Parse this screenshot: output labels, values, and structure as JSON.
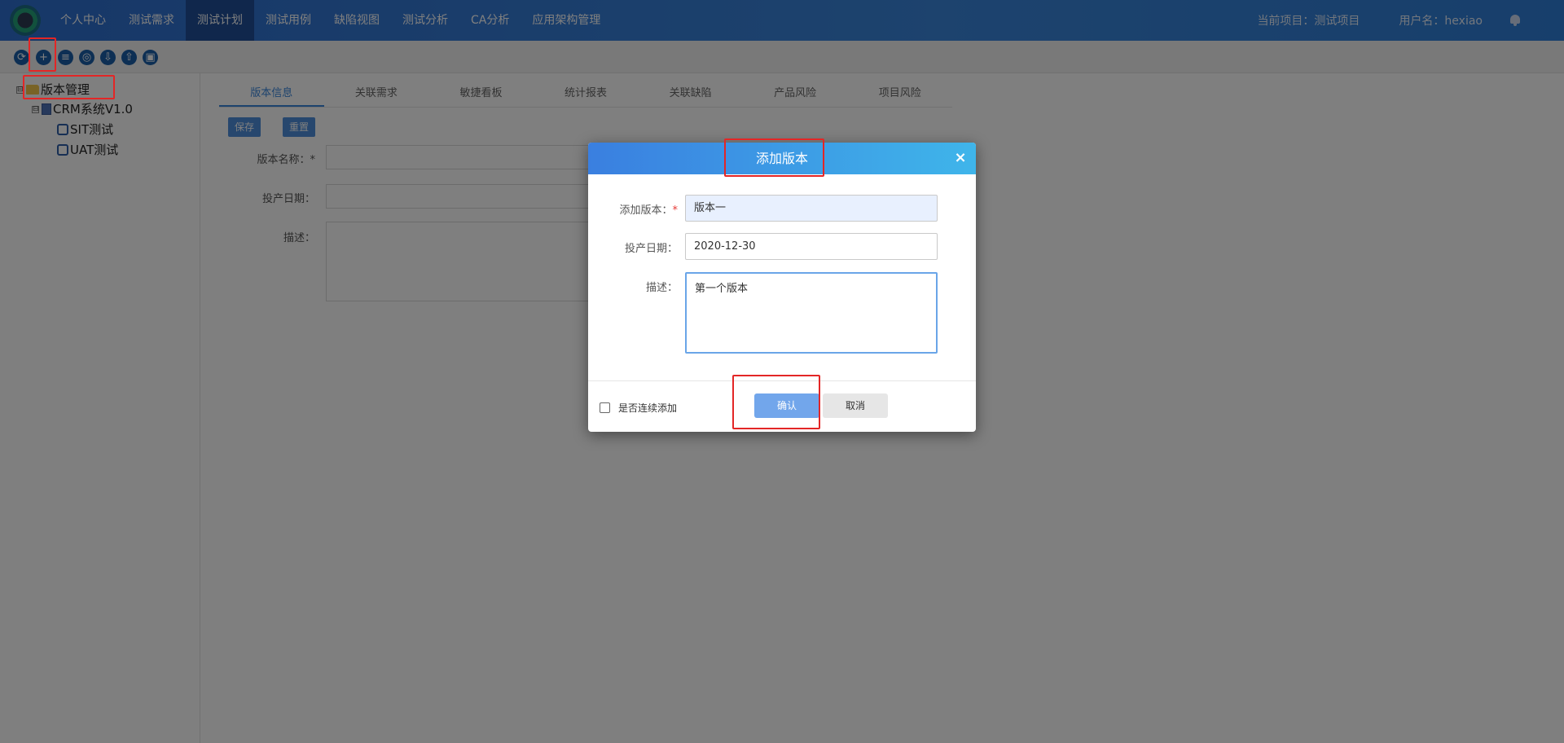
{
  "nav": {
    "items": [
      {
        "label": "个人中心"
      },
      {
        "label": "测试需求"
      },
      {
        "label": "测试计划",
        "active": true
      },
      {
        "label": "测试用例"
      },
      {
        "label": "缺陷视图"
      },
      {
        "label": "测试分析"
      },
      {
        "label": "CA分析"
      },
      {
        "label": "应用架构管理"
      }
    ],
    "current_project": "当前项目：测试项目",
    "username": "用户名：hexiao"
  },
  "toolbar": {
    "buttons": [
      {
        "icon": "refresh-icon",
        "glyph": "⟳"
      },
      {
        "icon": "add-icon",
        "glyph": "+"
      },
      {
        "icon": "layers-icon",
        "glyph": "≡"
      },
      {
        "icon": "settings-icon",
        "glyph": "◎"
      },
      {
        "icon": "download-icon",
        "glyph": "⇩"
      },
      {
        "icon": "upload-icon",
        "glyph": "⇧"
      },
      {
        "icon": "export-icon",
        "glyph": "▣"
      }
    ]
  },
  "tree": {
    "root": {
      "label": "版本管理",
      "toggle": "⊟"
    },
    "child": {
      "label": "CRM系统V1.0",
      "toggle": "⊟"
    },
    "leaves": [
      {
        "label": "SIT测试"
      },
      {
        "label": "UAT测试"
      }
    ]
  },
  "main": {
    "tabs": [
      "版本信息",
      "关联需求",
      "敏捷看板",
      "统计报表",
      "关联缺陷",
      "产品风险",
      "项目风险"
    ],
    "save_label": "保存",
    "reset_label": "重置",
    "form": {
      "name_label": "版本名称：*",
      "date_label": "投产日期：",
      "desc_label": "描述："
    }
  },
  "dialog": {
    "title": "添加版本",
    "close": "×",
    "version_label": "添加版本：",
    "required_mark": "*",
    "version_value": "版本一",
    "date_label": "投产日期：",
    "date_value": "2020-12-30",
    "desc_label": "描述：",
    "desc_value": "第一个版本",
    "continuous_add_label": "是否连续添加",
    "confirm_label": "确认",
    "cancel_label": "取消"
  },
  "colors": {
    "nav_bg": "#2e6fd0",
    "nav_active": "#204f98",
    "dialog_header_start": "#3a7fe0",
    "dialog_header_end": "#3fb5ea",
    "confirm": "#72a6eb",
    "highlight": "#e32626"
  }
}
